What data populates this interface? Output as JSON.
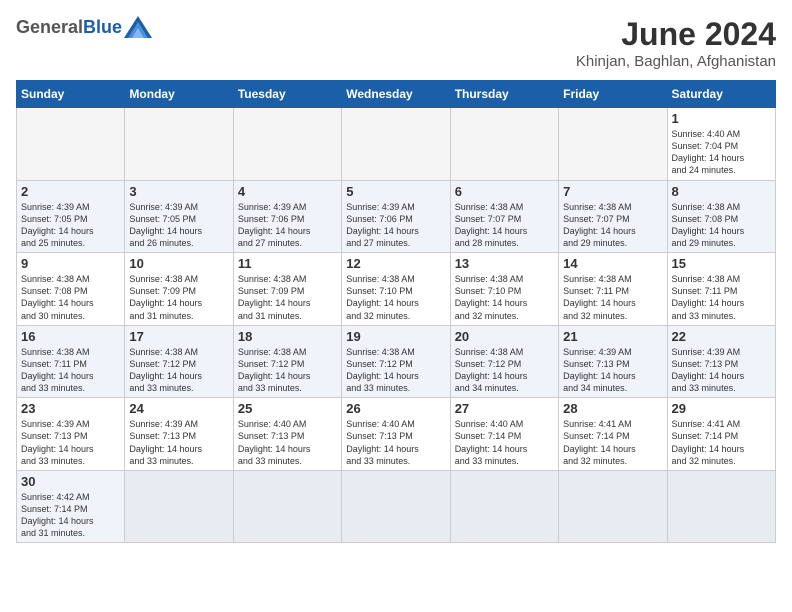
{
  "header": {
    "logo_general": "General",
    "logo_blue": "Blue",
    "month_title": "June 2024",
    "location": "Khinjan, Baghlan, Afghanistan"
  },
  "weekdays": [
    "Sunday",
    "Monday",
    "Tuesday",
    "Wednesday",
    "Thursday",
    "Friday",
    "Saturday"
  ],
  "weeks": [
    [
      {
        "day": "",
        "info": ""
      },
      {
        "day": "",
        "info": ""
      },
      {
        "day": "",
        "info": ""
      },
      {
        "day": "",
        "info": ""
      },
      {
        "day": "",
        "info": ""
      },
      {
        "day": "",
        "info": ""
      },
      {
        "day": "1",
        "info": "Sunrise: 4:40 AM\nSunset: 7:04 PM\nDaylight: 14 hours\nand 24 minutes."
      }
    ],
    [
      {
        "day": "2",
        "info": "Sunrise: 4:39 AM\nSunset: 7:05 PM\nDaylight: 14 hours\nand 25 minutes."
      },
      {
        "day": "3",
        "info": "Sunrise: 4:39 AM\nSunset: 7:05 PM\nDaylight: 14 hours\nand 26 minutes."
      },
      {
        "day": "4",
        "info": "Sunrise: 4:39 AM\nSunset: 7:06 PM\nDaylight: 14 hours\nand 27 minutes."
      },
      {
        "day": "5",
        "info": "Sunrise: 4:39 AM\nSunset: 7:06 PM\nDaylight: 14 hours\nand 27 minutes."
      },
      {
        "day": "6",
        "info": "Sunrise: 4:38 AM\nSunset: 7:07 PM\nDaylight: 14 hours\nand 28 minutes."
      },
      {
        "day": "7",
        "info": "Sunrise: 4:38 AM\nSunset: 7:07 PM\nDaylight: 14 hours\nand 29 minutes."
      },
      {
        "day": "8",
        "info": "Sunrise: 4:38 AM\nSunset: 7:08 PM\nDaylight: 14 hours\nand 29 minutes."
      }
    ],
    [
      {
        "day": "9",
        "info": "Sunrise: 4:38 AM\nSunset: 7:08 PM\nDaylight: 14 hours\nand 30 minutes."
      },
      {
        "day": "10",
        "info": "Sunrise: 4:38 AM\nSunset: 7:09 PM\nDaylight: 14 hours\nand 31 minutes."
      },
      {
        "day": "11",
        "info": "Sunrise: 4:38 AM\nSunset: 7:09 PM\nDaylight: 14 hours\nand 31 minutes."
      },
      {
        "day": "12",
        "info": "Sunrise: 4:38 AM\nSunset: 7:10 PM\nDaylight: 14 hours\nand 32 minutes."
      },
      {
        "day": "13",
        "info": "Sunrise: 4:38 AM\nSunset: 7:10 PM\nDaylight: 14 hours\nand 32 minutes."
      },
      {
        "day": "14",
        "info": "Sunrise: 4:38 AM\nSunset: 7:11 PM\nDaylight: 14 hours\nand 32 minutes."
      },
      {
        "day": "15",
        "info": "Sunrise: 4:38 AM\nSunset: 7:11 PM\nDaylight: 14 hours\nand 33 minutes."
      }
    ],
    [
      {
        "day": "16",
        "info": "Sunrise: 4:38 AM\nSunset: 7:11 PM\nDaylight: 14 hours\nand 33 minutes."
      },
      {
        "day": "17",
        "info": "Sunrise: 4:38 AM\nSunset: 7:12 PM\nDaylight: 14 hours\nand 33 minutes."
      },
      {
        "day": "18",
        "info": "Sunrise: 4:38 AM\nSunset: 7:12 PM\nDaylight: 14 hours\nand 33 minutes."
      },
      {
        "day": "19",
        "info": "Sunrise: 4:38 AM\nSunset: 7:12 PM\nDaylight: 14 hours\nand 33 minutes."
      },
      {
        "day": "20",
        "info": "Sunrise: 4:38 AM\nSunset: 7:12 PM\nDaylight: 14 hours\nand 34 minutes."
      },
      {
        "day": "21",
        "info": "Sunrise: 4:39 AM\nSunset: 7:13 PM\nDaylight: 14 hours\nand 34 minutes."
      },
      {
        "day": "22",
        "info": "Sunrise: 4:39 AM\nSunset: 7:13 PM\nDaylight: 14 hours\nand 33 minutes."
      }
    ],
    [
      {
        "day": "23",
        "info": "Sunrise: 4:39 AM\nSunset: 7:13 PM\nDaylight: 14 hours\nand 33 minutes."
      },
      {
        "day": "24",
        "info": "Sunrise: 4:39 AM\nSunset: 7:13 PM\nDaylight: 14 hours\nand 33 minutes."
      },
      {
        "day": "25",
        "info": "Sunrise: 4:40 AM\nSunset: 7:13 PM\nDaylight: 14 hours\nand 33 minutes."
      },
      {
        "day": "26",
        "info": "Sunrise: 4:40 AM\nSunset: 7:13 PM\nDaylight: 14 hours\nand 33 minutes."
      },
      {
        "day": "27",
        "info": "Sunrise: 4:40 AM\nSunset: 7:14 PM\nDaylight: 14 hours\nand 33 minutes."
      },
      {
        "day": "28",
        "info": "Sunrise: 4:41 AM\nSunset: 7:14 PM\nDaylight: 14 hours\nand 32 minutes."
      },
      {
        "day": "29",
        "info": "Sunrise: 4:41 AM\nSunset: 7:14 PM\nDaylight: 14 hours\nand 32 minutes."
      }
    ],
    [
      {
        "day": "30",
        "info": "Sunrise: 4:42 AM\nSunset: 7:14 PM\nDaylight: 14 hours\nand 31 minutes."
      },
      {
        "day": "",
        "info": ""
      },
      {
        "day": "",
        "info": ""
      },
      {
        "day": "",
        "info": ""
      },
      {
        "day": "",
        "info": ""
      },
      {
        "day": "",
        "info": ""
      },
      {
        "day": "",
        "info": ""
      }
    ]
  ]
}
